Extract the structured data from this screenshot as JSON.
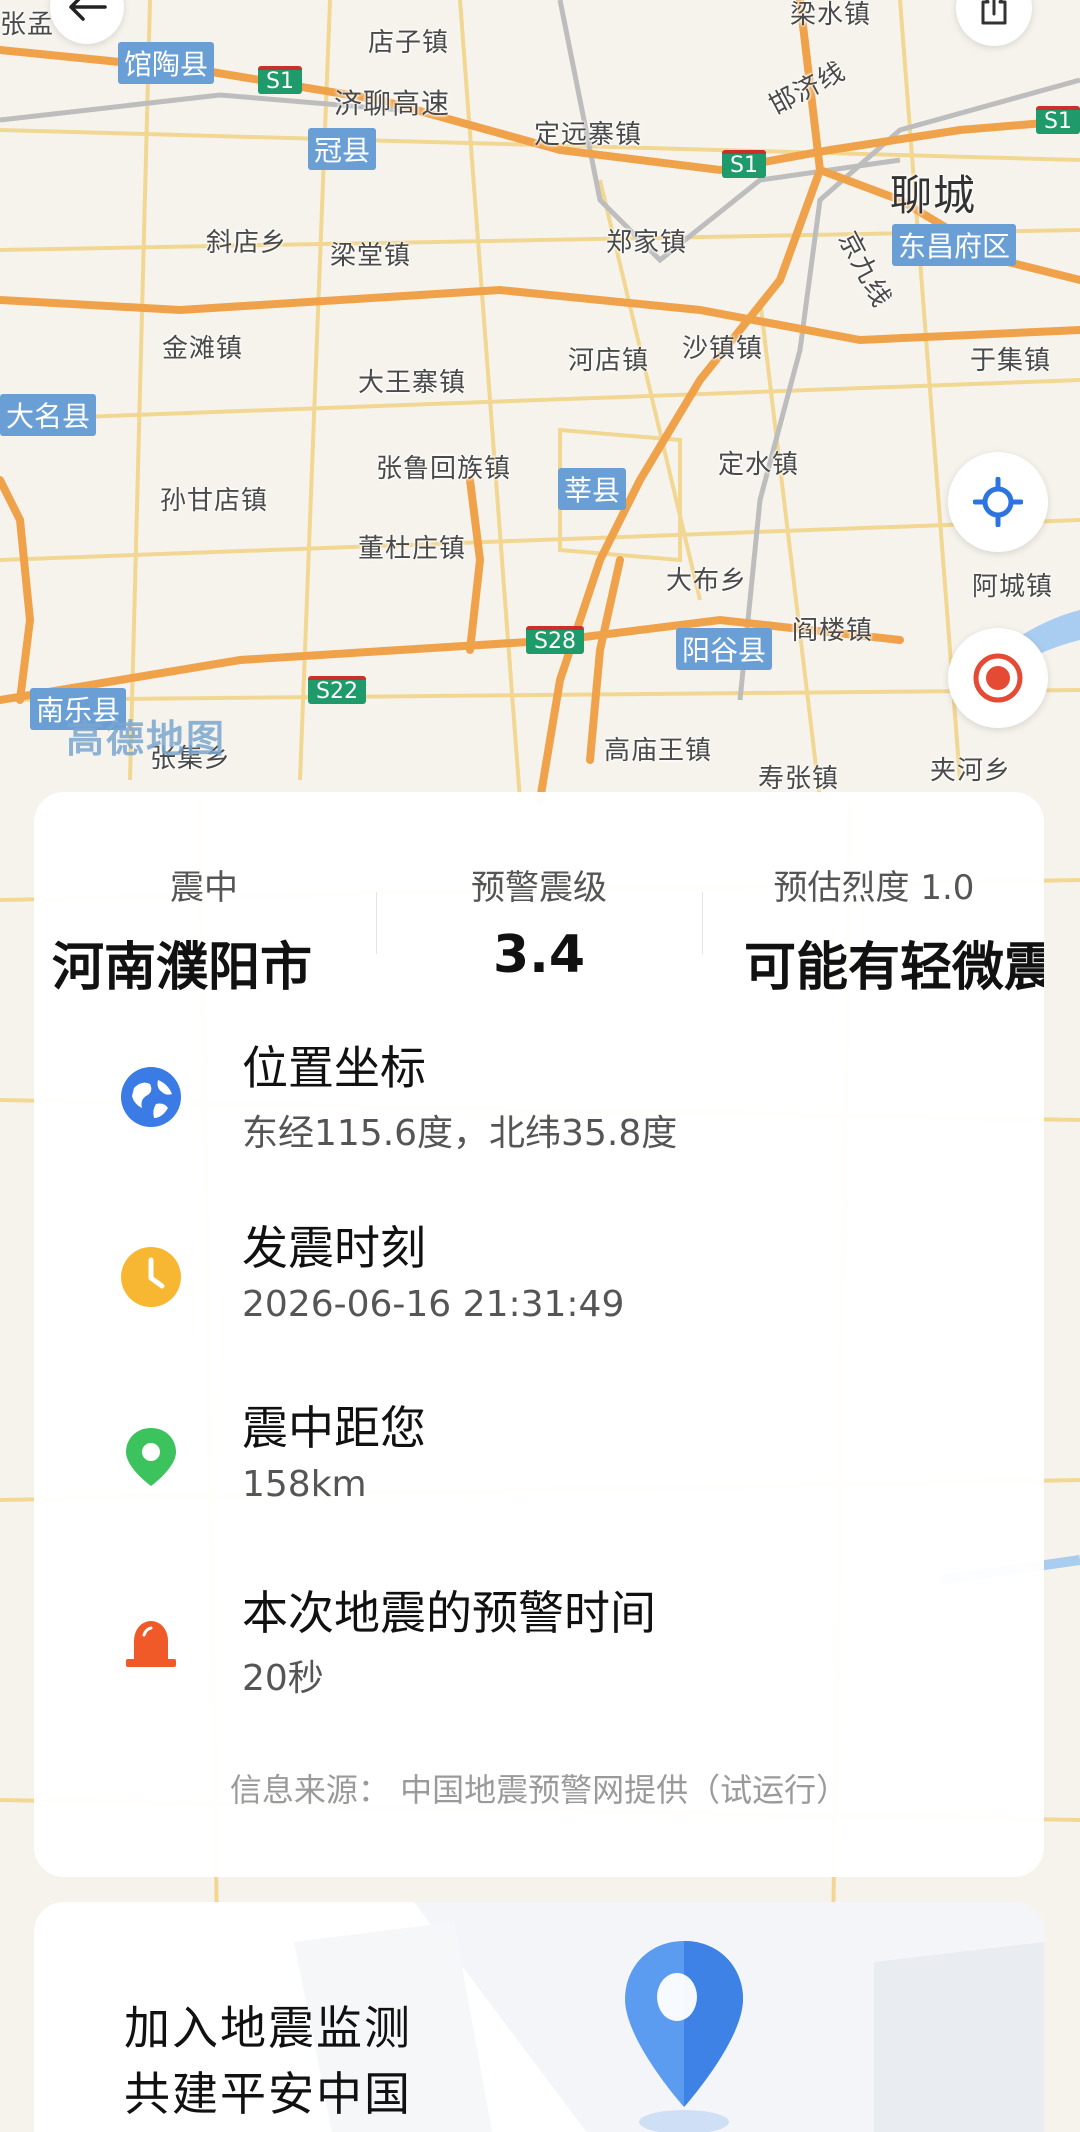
{
  "map": {
    "logo": "高德地图",
    "places": [
      {
        "name": "店子镇"
      },
      {
        "name": "济聊高速"
      },
      {
        "name": "定远寨镇"
      },
      {
        "name": "邯济线"
      },
      {
        "name": "梁水镇"
      },
      {
        "name": "斜店乡"
      },
      {
        "name": "梁堂镇"
      },
      {
        "name": "郑家镇"
      },
      {
        "name": "金滩镇"
      },
      {
        "name": "大王寨镇"
      },
      {
        "name": "河店镇"
      },
      {
        "name": "沙镇镇"
      },
      {
        "name": "于集镇"
      },
      {
        "name": "张鲁回族镇"
      },
      {
        "name": "定水镇"
      },
      {
        "name": "孙甘店镇"
      },
      {
        "name": "董杜庄镇"
      },
      {
        "name": "大布乡"
      },
      {
        "name": "阿城镇"
      },
      {
        "name": "阎楼镇"
      },
      {
        "name": "高庙王镇"
      },
      {
        "name": "寿张镇"
      },
      {
        "name": "夹河乡"
      },
      {
        "name": "张集乡"
      },
      {
        "name": "京九线"
      },
      {
        "name": "张孟"
      }
    ],
    "city": "聊城",
    "counties": [
      "馆陶县",
      "冠县",
      "东昌府区",
      "莘县",
      "阳谷县",
      "南乐县",
      "大名县"
    ],
    "roads": [
      "S1",
      "S1",
      "S1",
      "S28",
      "S22"
    ]
  },
  "buttons": {
    "back_icon": "arrow-left-icon",
    "share_icon": "share-icon",
    "locate_icon": "crosshair-icon",
    "epicenter_icon": "target-icon"
  },
  "info": {
    "stats": [
      {
        "label": "震中",
        "value": "河南濮阳市"
      },
      {
        "label": "预警震级",
        "value": "3.4"
      },
      {
        "label": "预估烈度 1.0",
        "value": "可能有轻微震"
      }
    ],
    "rows": [
      {
        "title": "位置坐标",
        "value": "东经115.6度，北纬35.8度",
        "icon": "globe-icon",
        "color": "#3a7be6"
      },
      {
        "title": "发震时刻",
        "value": "2026-06-16 21:31:49",
        "icon": "clock-icon",
        "color": "#f7b733"
      },
      {
        "title": "震中距您",
        "value": "158km",
        "icon": "location-pin-icon",
        "color": "#3cc35e"
      },
      {
        "title": "本次地震的预警时间",
        "value": "20秒",
        "icon": "alarm-icon",
        "color": "#f05a28"
      }
    ],
    "source": "信息来源：  中国地震预警网提供（试运行）"
  },
  "banner": {
    "line1": "加入地震监测",
    "line2": "共建平安中国",
    "icon": "location-pin-icon"
  }
}
